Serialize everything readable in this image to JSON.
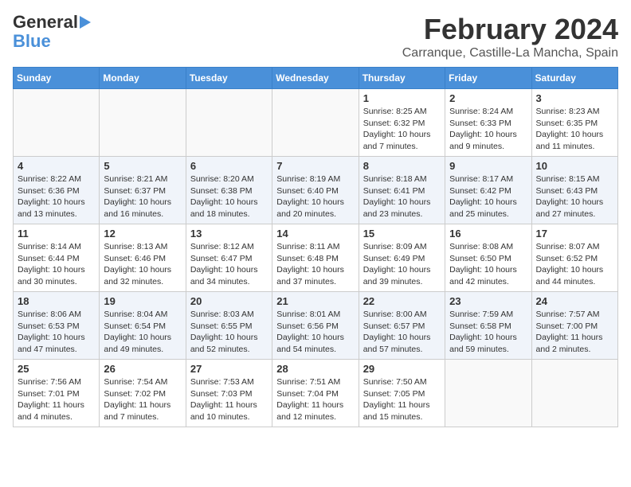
{
  "logo": {
    "line1": "General",
    "line2": "Blue"
  },
  "title": "February 2024",
  "subtitle": "Carranque, Castille-La Mancha, Spain",
  "weekdays": [
    "Sunday",
    "Monday",
    "Tuesday",
    "Wednesday",
    "Thursday",
    "Friday",
    "Saturday"
  ],
  "weeks": [
    [
      {
        "day": "",
        "info": ""
      },
      {
        "day": "",
        "info": ""
      },
      {
        "day": "",
        "info": ""
      },
      {
        "day": "",
        "info": ""
      },
      {
        "day": "1",
        "info": "Sunrise: 8:25 AM\nSunset: 6:32 PM\nDaylight: 10 hours\nand 7 minutes."
      },
      {
        "day": "2",
        "info": "Sunrise: 8:24 AM\nSunset: 6:33 PM\nDaylight: 10 hours\nand 9 minutes."
      },
      {
        "day": "3",
        "info": "Sunrise: 8:23 AM\nSunset: 6:35 PM\nDaylight: 10 hours\nand 11 minutes."
      }
    ],
    [
      {
        "day": "4",
        "info": "Sunrise: 8:22 AM\nSunset: 6:36 PM\nDaylight: 10 hours\nand 13 minutes."
      },
      {
        "day": "5",
        "info": "Sunrise: 8:21 AM\nSunset: 6:37 PM\nDaylight: 10 hours\nand 16 minutes."
      },
      {
        "day": "6",
        "info": "Sunrise: 8:20 AM\nSunset: 6:38 PM\nDaylight: 10 hours\nand 18 minutes."
      },
      {
        "day": "7",
        "info": "Sunrise: 8:19 AM\nSunset: 6:40 PM\nDaylight: 10 hours\nand 20 minutes."
      },
      {
        "day": "8",
        "info": "Sunrise: 8:18 AM\nSunset: 6:41 PM\nDaylight: 10 hours\nand 23 minutes."
      },
      {
        "day": "9",
        "info": "Sunrise: 8:17 AM\nSunset: 6:42 PM\nDaylight: 10 hours\nand 25 minutes."
      },
      {
        "day": "10",
        "info": "Sunrise: 8:15 AM\nSunset: 6:43 PM\nDaylight: 10 hours\nand 27 minutes."
      }
    ],
    [
      {
        "day": "11",
        "info": "Sunrise: 8:14 AM\nSunset: 6:44 PM\nDaylight: 10 hours\nand 30 minutes."
      },
      {
        "day": "12",
        "info": "Sunrise: 8:13 AM\nSunset: 6:46 PM\nDaylight: 10 hours\nand 32 minutes."
      },
      {
        "day": "13",
        "info": "Sunrise: 8:12 AM\nSunset: 6:47 PM\nDaylight: 10 hours\nand 34 minutes."
      },
      {
        "day": "14",
        "info": "Sunrise: 8:11 AM\nSunset: 6:48 PM\nDaylight: 10 hours\nand 37 minutes."
      },
      {
        "day": "15",
        "info": "Sunrise: 8:09 AM\nSunset: 6:49 PM\nDaylight: 10 hours\nand 39 minutes."
      },
      {
        "day": "16",
        "info": "Sunrise: 8:08 AM\nSunset: 6:50 PM\nDaylight: 10 hours\nand 42 minutes."
      },
      {
        "day": "17",
        "info": "Sunrise: 8:07 AM\nSunset: 6:52 PM\nDaylight: 10 hours\nand 44 minutes."
      }
    ],
    [
      {
        "day": "18",
        "info": "Sunrise: 8:06 AM\nSunset: 6:53 PM\nDaylight: 10 hours\nand 47 minutes."
      },
      {
        "day": "19",
        "info": "Sunrise: 8:04 AM\nSunset: 6:54 PM\nDaylight: 10 hours\nand 49 minutes."
      },
      {
        "day": "20",
        "info": "Sunrise: 8:03 AM\nSunset: 6:55 PM\nDaylight: 10 hours\nand 52 minutes."
      },
      {
        "day": "21",
        "info": "Sunrise: 8:01 AM\nSunset: 6:56 PM\nDaylight: 10 hours\nand 54 minutes."
      },
      {
        "day": "22",
        "info": "Sunrise: 8:00 AM\nSunset: 6:57 PM\nDaylight: 10 hours\nand 57 minutes."
      },
      {
        "day": "23",
        "info": "Sunrise: 7:59 AM\nSunset: 6:58 PM\nDaylight: 10 hours\nand 59 minutes."
      },
      {
        "day": "24",
        "info": "Sunrise: 7:57 AM\nSunset: 7:00 PM\nDaylight: 11 hours\nand 2 minutes."
      }
    ],
    [
      {
        "day": "25",
        "info": "Sunrise: 7:56 AM\nSunset: 7:01 PM\nDaylight: 11 hours\nand 4 minutes."
      },
      {
        "day": "26",
        "info": "Sunrise: 7:54 AM\nSunset: 7:02 PM\nDaylight: 11 hours\nand 7 minutes."
      },
      {
        "day": "27",
        "info": "Sunrise: 7:53 AM\nSunset: 7:03 PM\nDaylight: 11 hours\nand 10 minutes."
      },
      {
        "day": "28",
        "info": "Sunrise: 7:51 AM\nSunset: 7:04 PM\nDaylight: 11 hours\nand 12 minutes."
      },
      {
        "day": "29",
        "info": "Sunrise: 7:50 AM\nSunset: 7:05 PM\nDaylight: 11 hours\nand 15 minutes."
      },
      {
        "day": "",
        "info": ""
      },
      {
        "day": "",
        "info": ""
      }
    ]
  ]
}
